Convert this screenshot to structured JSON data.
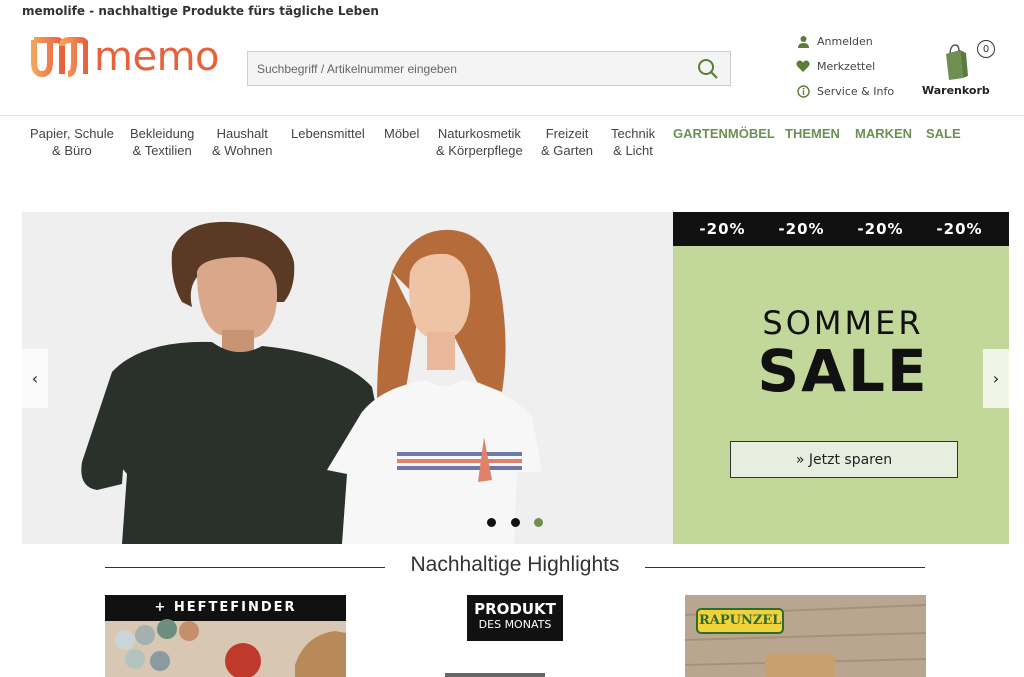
{
  "header": {
    "tagline": "memolife - nachhaltige Produkte fürs tägliche Leben",
    "logo_text": "memo",
    "search_placeholder": "Suchbegriff / Artikelnummer eingeben",
    "account": [
      {
        "label": "Anmelden",
        "icon": "user-icon"
      },
      {
        "label": "Merkzettel",
        "icon": "heart-icon"
      },
      {
        "label": "Service & Info",
        "icon": "info-icon"
      }
    ],
    "cart": {
      "label": "Warenkorb",
      "count": "0",
      "icon": "shopping-bag-icon"
    }
  },
  "nav": [
    {
      "line1": "Papier, Schule",
      "line2": "& Büro"
    },
    {
      "line1": "Bekleidung",
      "line2": "& Textilien"
    },
    {
      "line1": "Haushalt",
      "line2": "& Wohnen"
    },
    {
      "line1": "Lebensmittel",
      "line2": ""
    },
    {
      "line1": "Möbel",
      "line2": ""
    },
    {
      "line1": "Naturkosmetik",
      "line2": "& Körperpflege"
    },
    {
      "line1": "Freizeit",
      "line2": "& Garten"
    },
    {
      "line1": "Technik",
      "line2": "& Licht"
    },
    {
      "line1": "GARTENMÖBEL",
      "line2": ""
    },
    {
      "line1": "THEMEN",
      "line2": ""
    },
    {
      "line1": "MARKEN",
      "line2": ""
    },
    {
      "line1": "SALE",
      "line2": ""
    }
  ],
  "hero": {
    "discounts": [
      "-20%",
      "-20%",
      "-20%",
      "-20%"
    ],
    "headline_top": "SOMMER",
    "headline_main": "SALE",
    "cta": "» Jetzt sparen",
    "prev_icon": "chevron-left-icon",
    "next_icon": "chevron-right-icon",
    "slides": 3,
    "active_slide": 3
  },
  "section": {
    "title": "Nachhaltige Highlights"
  },
  "cards": [
    {
      "badge": "+ HEFTEFINDER"
    },
    {
      "badge_line1": "PRODUKT",
      "badge_line2": "DES MONATS"
    },
    {
      "brand": "RAPUNZEL"
    }
  ],
  "colors": {
    "brand_orange": "#e8613d",
    "accent_green": "#6e8f52",
    "promo_green": "#c2d79a"
  }
}
